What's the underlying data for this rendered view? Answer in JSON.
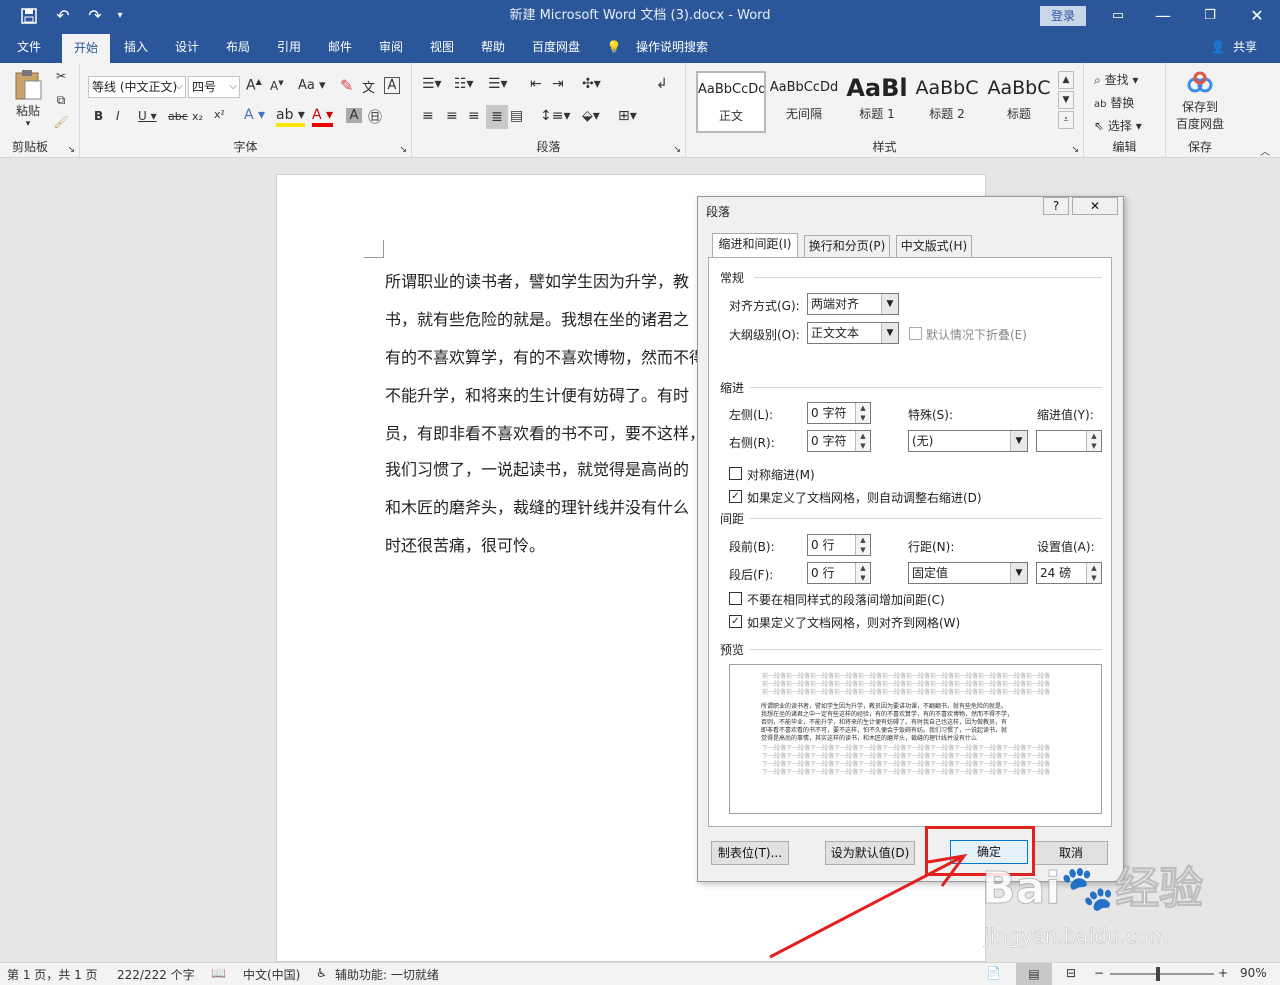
{
  "titlebar": {
    "doc_title": "新建 Microsoft Word 文档 (3).docx  -  Word",
    "login": "登录"
  },
  "tabs": [
    "文件",
    "开始",
    "插入",
    "设计",
    "布局",
    "引用",
    "邮件",
    "审阅",
    "视图",
    "帮助",
    "百度网盘"
  ],
  "tell_me": "操作说明搜索",
  "share": "共享",
  "ribbon": {
    "clipboard": {
      "paste": "粘贴",
      "label": "剪贴板"
    },
    "font": {
      "family": "等线 (中文正文)",
      "size": "四号",
      "label": "字体"
    },
    "paragraph": {
      "label": "段落"
    },
    "styles": {
      "label": "样式",
      "items": [
        {
          "sample": "AaBbCcDd",
          "name": "正文"
        },
        {
          "sample": "AaBbCcDd",
          "name": "无间隔"
        },
        {
          "sample": "AaBl",
          "name": "标题 1"
        },
        {
          "sample": "AaBbC",
          "name": "标题 2"
        },
        {
          "sample": "AaBbC",
          "name": "标题"
        }
      ]
    },
    "editing": {
      "find": "查找",
      "replace": "替换",
      "select": "选择",
      "label": "编辑"
    },
    "save": {
      "btn": "保存到\n百度网盘",
      "line1": "保存到",
      "line2": "百度网盘",
      "label": "保存"
    }
  },
  "document": {
    "lines": [
      "所谓职业的读书者，譬如学生因为升学，教",
      "书，就有些危险的就是。我想在坐的诸君之",
      "有的不喜欢算学，有的不喜欢博物，然而不得",
      "不能升学，和将来的生计便有妨碍了。有时",
      "员，有即非看不喜欢看的书不可，要不这样，",
      "我们习惯了，一说起读书，就觉得是高尚的",
      "和木匠的磨斧头，裁缝的理针线并没有什么",
      "时还很苦痛，很可怜。"
    ]
  },
  "dialog": {
    "title": "段落",
    "help": "?",
    "tabs": [
      "缩进和间距(I)",
      "换行和分页(P)",
      "中文版式(H)"
    ],
    "general": {
      "section": "常规",
      "alignment_label": "对齐方式(G):",
      "alignment_value": "两端对齐",
      "outline_label": "大纲级别(O):",
      "outline_value": "正文文本",
      "collapse_label": "默认情况下折叠(E)"
    },
    "indent": {
      "section": "缩进",
      "left_label": "左侧(L):",
      "left_value": "0 字符",
      "right_label": "右侧(R):",
      "right_value": "0 字符",
      "special_label": "特殊(S):",
      "special_value": "(无)",
      "by_label": "缩进值(Y):",
      "by_value": "",
      "mirror_label": "对称缩进(M)",
      "auto_label": "如果定义了文档网格，则自动调整右缩进(D)"
    },
    "spacing": {
      "section": "间距",
      "before_label": "段前(B):",
      "before_value": "0 行",
      "after_label": "段后(F):",
      "after_value": "0 行",
      "line_label": "行距(N):",
      "line_value": "固定值",
      "at_label": "设置值(A):",
      "at_value": "24 磅",
      "nospace_label": "不要在相同样式的段落间增加间距(C)",
      "grid_label": "如果定义了文档网格，则对齐到网格(W)"
    },
    "preview": {
      "section": "预览",
      "prev": "前一段落前一段落前一段落前一段落前一段落前一段落前一段落前一段落前一段落前一段落前一段落前一段落",
      "text1": "所谓职业的读书者，譬如学生因为升学，教员因为要讲功课，不翻翻书，就有些危险的就是。",
      "text2": "我想在坐的诸君之中一定有些这样的经验，有的不喜欢算学，有的不喜欢博物，然而不得不学，",
      "text3": "否则，不能毕业，不能升学，和将来的生计便有妨碍了。有时我自己也这样，因为做教员，有",
      "text4": "即非看不喜欢看的书不可，要不这样，怕不久便会于饭碗有妨。我们习惯了，一说起读书，就",
      "text5": "觉得是高尚的事情，其实这样的读书，和木匠的磨斧头，裁缝的理针线并没有什么",
      "next": "下一段落下一段落下一段落下一段落下一段落下一段落下一段落下一段落下一段落下一段落下一段落下一段落"
    },
    "buttons": {
      "tabs": "制表位(T)...",
      "default": "设为默认值(D)",
      "ok": "确定",
      "cancel": "取消"
    }
  },
  "statusbar": {
    "page": "第 1 页，共 1 页",
    "words": "222/222 个字",
    "lang": "中文(中国)",
    "access": "辅助功能: 一切就绪",
    "zoom": "90%"
  },
  "watermark": {
    "brand": "Bai",
    "brand2": "经验",
    "url": "jingyan.baidu.com"
  },
  "colors": {
    "word_blue": "#2b579a",
    "highlight_red": "#e32020",
    "ribbon_bg": "#f3f3f3"
  }
}
